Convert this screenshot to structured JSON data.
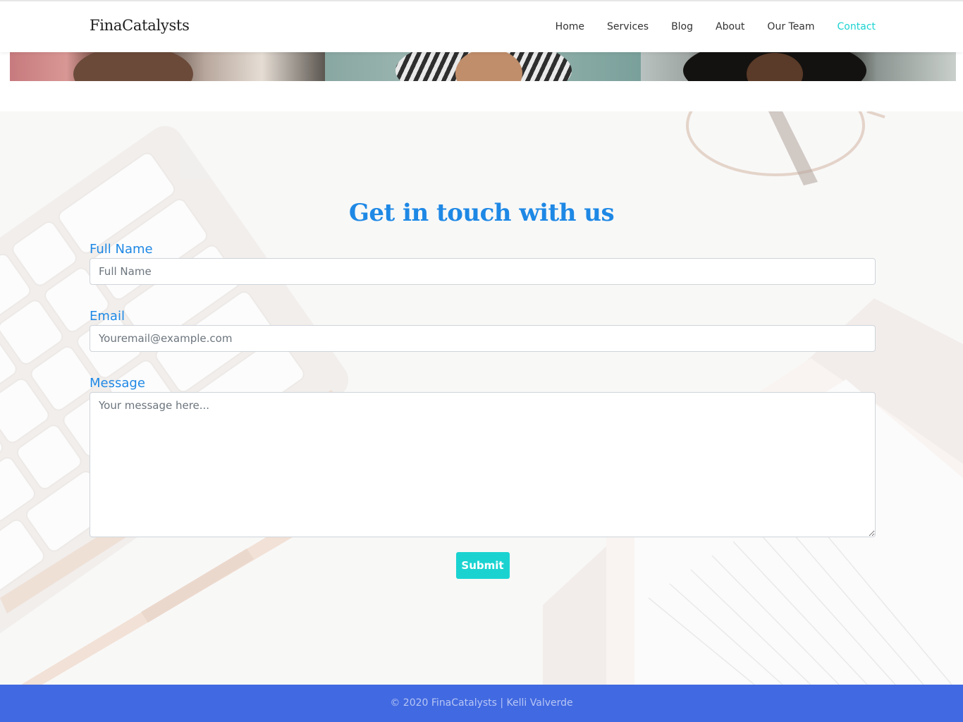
{
  "header": {
    "brand": "FinaCatalysts",
    "nav": [
      {
        "label": "Home"
      },
      {
        "label": "Services"
      },
      {
        "label": "Blog"
      },
      {
        "label": "About"
      },
      {
        "label": "Our Team"
      },
      {
        "label": "Contact"
      }
    ],
    "active_nav": "Contact"
  },
  "contact": {
    "heading": "Get in touch with us",
    "full_name": {
      "label": "Full Name",
      "placeholder": "Full Name",
      "value": ""
    },
    "email": {
      "label": "Email",
      "placeholder": "Youremail@example.com",
      "value": ""
    },
    "message": {
      "label": "Message",
      "placeholder": "Your message here...",
      "value": ""
    },
    "submit_label": "Submit"
  },
  "footer": {
    "text": "© 2020 FinaCatalysts | Kelli Valverde"
  },
  "colors": {
    "accent": "#1ad3d1",
    "heading_blue": "#1e88e5",
    "footer_bg": "#4169e1"
  }
}
